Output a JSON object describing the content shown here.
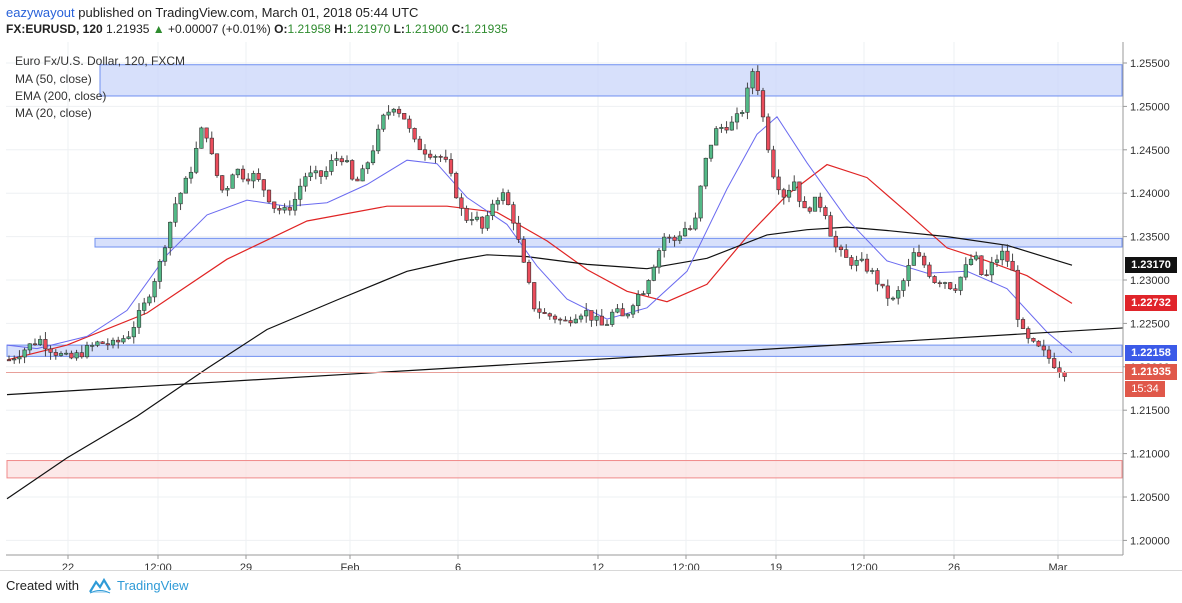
{
  "header": {
    "username": "eazywayout",
    "published_text": "published on TradingView.com, March 01, 2018 05:44 UTC",
    "symbol": "FX:EURUSD, 120",
    "last": "1.21935",
    "change_arrow": "▲",
    "change": "+0.00007 (+0.01%)",
    "o_label": "O:",
    "o_value": "1.21958",
    "h_label": "H:",
    "h_value": "1.21970",
    "l_label": "L:",
    "l_value": "1.21900",
    "c_label": "C:",
    "c_value": "1.21935"
  },
  "legend": {
    "title": "Euro Fx/U.S. Dollar, 120, FXCM",
    "ma50": "MA (50, close)",
    "ema200": "EMA (200, close)",
    "ma20": "MA (20, close)"
  },
  "price_labels": {
    "ema200": "1.23170",
    "ma50": "1.22732",
    "ma20": "1.22158",
    "last": "1.21935",
    "countdown": "15:34"
  },
  "footer": {
    "created_with": "Created with",
    "brand": "TradingView"
  },
  "colors": {
    "up_candle": "#53b987",
    "down_candle": "#eb4d5c",
    "ma50": "#e02424",
    "ema200": "#111111",
    "ma20": "#6b6bf0",
    "zone_blue": "#c9d6fa",
    "zone_red": "#fbe0e0",
    "ema_label_bg": "#111111",
    "ma50_label_bg": "#e0242a",
    "ma20_label_bg": "#3b5ae8",
    "last_label_bg": "#e0584a"
  },
  "chart_data": {
    "type": "candlestick",
    "title": "Euro Fx/U.S. Dollar, 120, FXCM",
    "ylim": [
      1.2,
      1.257
    ],
    "y_ticks": [
      "1.25500",
      "1.25000",
      "1.24500",
      "1.24000",
      "1.23500",
      "1.23000",
      "1.22500",
      "1.22000",
      "1.21500",
      "1.21000",
      "1.20500",
      "1.20000"
    ],
    "x_ticks": [
      "22",
      "12:00",
      "29",
      "Feb",
      "6",
      "12",
      "12:00",
      "19",
      "12:00",
      "26",
      "Mar"
    ],
    "grid": true,
    "series": [
      {
        "name": "MA (50, close)",
        "points": [
          [
            0,
            1.2208
          ],
          [
            60,
            1.2225
          ],
          [
            140,
            1.2262
          ],
          [
            220,
            1.2324
          ],
          [
            300,
            1.2368
          ],
          [
            380,
            1.2385
          ],
          [
            440,
            1.2385
          ],
          [
            490,
            1.2378
          ],
          [
            540,
            1.2345
          ],
          [
            580,
            1.2312
          ],
          [
            620,
            1.2287
          ],
          [
            660,
            1.2275
          ],
          [
            700,
            1.2295
          ],
          [
            740,
            1.235
          ],
          [
            780,
            1.2398
          ],
          [
            820,
            1.2433
          ],
          [
            860,
            1.2418
          ],
          [
            900,
            1.2378
          ],
          [
            940,
            1.2337
          ],
          [
            980,
            1.2322
          ],
          [
            1020,
            1.2305
          ],
          [
            1065,
            1.2273
          ]
        ]
      },
      {
        "name": "EMA (200, close)",
        "points": [
          [
            0,
            1.2048
          ],
          [
            60,
            1.2095
          ],
          [
            130,
            1.2143
          ],
          [
            200,
            1.2198
          ],
          [
            260,
            1.2243
          ],
          [
            330,
            1.2277
          ],
          [
            400,
            1.231
          ],
          [
            450,
            1.2323
          ],
          [
            480,
            1.2329
          ],
          [
            520,
            1.2327
          ],
          [
            580,
            1.2318
          ],
          [
            640,
            1.2313
          ],
          [
            700,
            1.2325
          ],
          [
            760,
            1.2352
          ],
          [
            800,
            1.2358
          ],
          [
            840,
            1.2361
          ],
          [
            880,
            1.2357
          ],
          [
            940,
            1.235
          ],
          [
            1000,
            1.234
          ],
          [
            1065,
            1.2317
          ]
        ]
      },
      {
        "name": "MA (20, close)",
        "points": [
          [
            0,
            1.2225
          ],
          [
            30,
            1.2221
          ],
          [
            80,
            1.2235
          ],
          [
            120,
            1.2265
          ],
          [
            160,
            1.2329
          ],
          [
            200,
            1.2375
          ],
          [
            240,
            1.2392
          ],
          [
            280,
            1.2385
          ],
          [
            320,
            1.2389
          ],
          [
            360,
            1.241
          ],
          [
            400,
            1.2438
          ],
          [
            430,
            1.2434
          ],
          [
            460,
            1.2395
          ],
          [
            500,
            1.2364
          ],
          [
            530,
            1.2316
          ],
          [
            560,
            1.2278
          ],
          [
            600,
            1.2255
          ],
          [
            640,
            1.2268
          ],
          [
            680,
            1.231
          ],
          [
            720,
            1.2405
          ],
          [
            750,
            1.2468
          ],
          [
            770,
            1.2488
          ],
          [
            800,
            1.2435
          ],
          [
            840,
            1.237
          ],
          [
            880,
            1.2322
          ],
          [
            920,
            1.2308
          ],
          [
            960,
            1.231
          ],
          [
            1000,
            1.229
          ],
          [
            1040,
            1.224
          ],
          [
            1065,
            1.2216
          ]
        ]
      },
      {
        "name": "Trendline",
        "points": [
          [
            0,
            1.2168
          ],
          [
            1120,
            1.2245
          ]
        ]
      }
    ],
    "zones": [
      {
        "color": "blue",
        "y1": 1.2512,
        "y2": 1.2548,
        "x1": 100,
        "x2": 1122
      },
      {
        "color": "blue",
        "y1": 1.2338,
        "y2": 1.2348,
        "x1": 95,
        "x2": 1122
      },
      {
        "color": "blue",
        "y1": 1.2212,
        "y2": 1.2225,
        "x1": 7,
        "x2": 1122
      },
      {
        "color": "red",
        "y1": 1.2072,
        "y2": 1.2092,
        "x1": 7,
        "x2": 1122
      }
    ],
    "candles_path": [
      [
        0,
        1.2208
      ],
      [
        15,
        1.222
      ],
      [
        30,
        1.2232
      ],
      [
        45,
        1.2218
      ],
      [
        60,
        1.2208
      ],
      [
        75,
        1.2218
      ],
      [
        90,
        1.2228
      ],
      [
        105,
        1.2225
      ],
      [
        120,
        1.2238
      ],
      [
        135,
        1.227
      ],
      [
        150,
        1.2315
      ],
      [
        165,
        1.2385
      ],
      [
        180,
        1.242
      ],
      [
        195,
        1.2482
      ],
      [
        205,
        1.243
      ],
      [
        215,
        1.2398
      ],
      [
        225,
        1.243
      ],
      [
        235,
        1.242
      ],
      [
        245,
        1.242
      ],
      [
        255,
        1.2405
      ],
      [
        265,
        1.2385
      ],
      [
        275,
        1.2378
      ],
      [
        285,
        1.239
      ],
      [
        295,
        1.242
      ],
      [
        305,
        1.242
      ],
      [
        315,
        1.242
      ],
      [
        325,
        1.244
      ],
      [
        335,
        1.2442
      ],
      [
        345,
        1.2408
      ],
      [
        355,
        1.2425
      ],
      [
        365,
        1.2455
      ],
      [
        375,
        1.2488
      ],
      [
        385,
        1.2502
      ],
      [
        395,
        1.2488
      ],
      [
        405,
        1.2458
      ],
      [
        415,
        1.245
      ],
      [
        425,
        1.2445
      ],
      [
        435,
        1.244
      ],
      [
        445,
        1.2408
      ],
      [
        455,
        1.237
      ],
      [
        465,
        1.2375
      ],
      [
        475,
        1.2355
      ],
      [
        485,
        1.2395
      ],
      [
        495,
        1.2398
      ],
      [
        505,
        1.2368
      ],
      [
        515,
        1.2315
      ],
      [
        525,
        1.227
      ],
      [
        535,
        1.226
      ],
      [
        545,
        1.2258
      ],
      [
        555,
        1.225
      ],
      [
        565,
        1.226
      ],
      [
        575,
        1.2265
      ],
      [
        585,
        1.2255
      ],
      [
        595,
        1.2245
      ],
      [
        605,
        1.2265
      ],
      [
        615,
        1.2255
      ],
      [
        625,
        1.2278
      ],
      [
        635,
        1.229
      ],
      [
        645,
        1.232
      ],
      [
        655,
        1.235
      ],
      [
        665,
        1.2345
      ],
      [
        675,
        1.236
      ],
      [
        685,
        1.2358
      ],
      [
        695,
        1.243
      ],
      [
        705,
        1.247
      ],
      [
        715,
        1.2478
      ],
      [
        725,
        1.248
      ],
      [
        735,
        1.25
      ],
      [
        745,
        1.2548
      ],
      [
        755,
        1.248
      ],
      [
        765,
        1.242
      ],
      [
        775,
        1.2398
      ],
      [
        785,
        1.2415
      ],
      [
        795,
        1.2378
      ],
      [
        805,
        1.239
      ],
      [
        815,
        1.2385
      ],
      [
        825,
        1.234
      ],
      [
        835,
        1.2325
      ],
      [
        845,
        1.232
      ],
      [
        855,
        1.2318
      ],
      [
        865,
        1.2305
      ],
      [
        875,
        1.2285
      ],
      [
        885,
        1.2275
      ],
      [
        895,
        1.23
      ],
      [
        905,
        1.233
      ],
      [
        915,
        1.2318
      ],
      [
        925,
        1.23
      ],
      [
        935,
        1.23
      ],
      [
        945,
        1.229
      ],
      [
        955,
        1.231
      ],
      [
        965,
        1.233
      ],
      [
        975,
        1.2298
      ],
      [
        985,
        1.2322
      ],
      [
        995,
        1.2332
      ],
      [
        1005,
        1.2305
      ],
      [
        1010,
        1.2245
      ],
      [
        1020,
        1.2228
      ],
      [
        1030,
        1.222
      ],
      [
        1040,
        1.221
      ],
      [
        1050,
        1.2198
      ],
      [
        1060,
        1.2192
      ],
      [
        1065,
        1.2194
      ]
    ]
  }
}
